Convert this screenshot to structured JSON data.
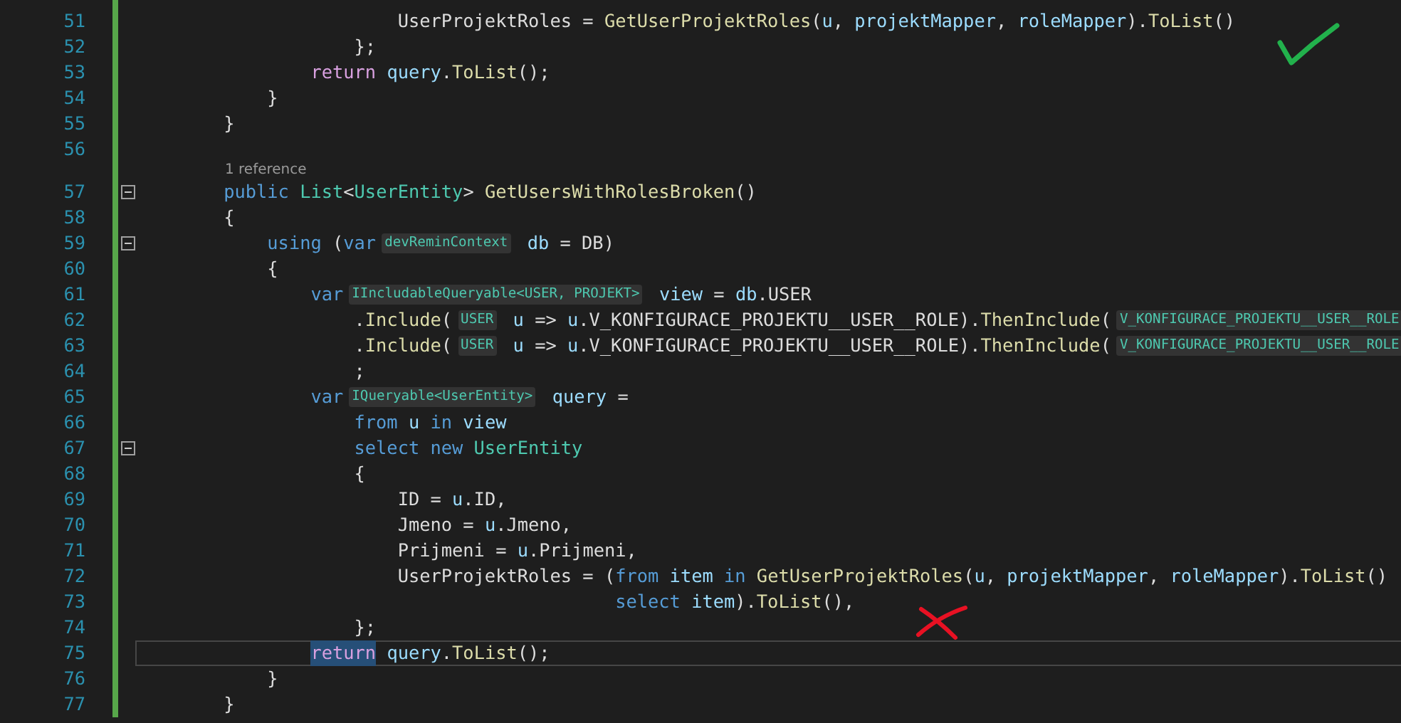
{
  "editor": {
    "modified": true,
    "lines": [
      {
        "kind": "code",
        "number": "51",
        "tokens": [
          {
            "text": "                        UserProjektRoles = ",
            "kind": "plain"
          },
          {
            "text": "GetUserProjektRoles",
            "kind": "method"
          },
          {
            "text": "(",
            "kind": "plain"
          },
          {
            "text": "u",
            "kind": "local"
          },
          {
            "text": ", ",
            "kind": "plain"
          },
          {
            "text": "projektMapper",
            "kind": "local"
          },
          {
            "text": ", ",
            "kind": "plain"
          },
          {
            "text": "roleMapper",
            "kind": "local"
          },
          {
            "text": ").",
            "kind": "plain"
          },
          {
            "text": "ToList",
            "kind": "method"
          },
          {
            "text": "()",
            "kind": "plain"
          }
        ]
      },
      {
        "kind": "code",
        "number": "52",
        "tokens": [
          {
            "text": "                    };",
            "kind": "plain"
          }
        ]
      },
      {
        "kind": "code",
        "number": "53",
        "tokens": [
          {
            "text": "                return",
            "kind": "control"
          },
          {
            "text": " query",
            "kind": "local"
          },
          {
            "text": ".",
            "kind": "plain"
          },
          {
            "text": "ToList",
            "kind": "method"
          },
          {
            "text": "();",
            "kind": "plain"
          }
        ]
      },
      {
        "kind": "code",
        "number": "54",
        "tokens": [
          {
            "text": "            }",
            "kind": "plain"
          }
        ]
      },
      {
        "kind": "code",
        "number": "55",
        "tokens": [
          {
            "text": "        }",
            "kind": "plain"
          }
        ]
      },
      {
        "kind": "code",
        "number": "56"
      },
      {
        "kind": "codelens",
        "text": "1 reference"
      },
      {
        "kind": "code",
        "number": "57",
        "expanded": true,
        "tokens": [
          {
            "text": "        public",
            "kind": "keyword"
          },
          {
            "text": " List",
            "kind": "type"
          },
          {
            "text": "<",
            "kind": "plain"
          },
          {
            "text": "UserEntity",
            "kind": "type"
          },
          {
            "text": "> ",
            "kind": "plain"
          },
          {
            "text": "GetUsersWithRolesBroken",
            "kind": "method"
          },
          {
            "text": "()",
            "kind": "plain"
          }
        ]
      },
      {
        "kind": "code",
        "number": "58",
        "tokens": [
          {
            "text": "        {",
            "kind": "plain"
          }
        ]
      },
      {
        "kind": "code",
        "number": "59",
        "expanded": true,
        "tokens": [
          {
            "text": "            using",
            "kind": "keyword"
          },
          {
            "text": " (",
            "kind": "plain"
          },
          {
            "text": "var",
            "kind": "keyword"
          },
          {
            "text": "devReminContext",
            "kind": "hint"
          },
          {
            "text": " db",
            "kind": "local"
          },
          {
            "text": " = DB)",
            "kind": "plain"
          }
        ]
      },
      {
        "kind": "code",
        "number": "60",
        "tokens": [
          {
            "text": "            {",
            "kind": "plain"
          }
        ]
      },
      {
        "kind": "code",
        "number": "61",
        "tokens": [
          {
            "text": "                var",
            "kind": "keyword"
          },
          {
            "text": "IIncludableQueryable<USER, PROJEKT>",
            "kind": "hint"
          },
          {
            "text": " view",
            "kind": "local"
          },
          {
            "text": " = ",
            "kind": "plain"
          },
          {
            "text": "db",
            "kind": "local"
          },
          {
            "text": ".USER",
            "kind": "plain"
          }
        ]
      },
      {
        "kind": "code",
        "number": "62",
        "tokens": [
          {
            "text": "                    .",
            "kind": "plain"
          },
          {
            "text": "Include",
            "kind": "method"
          },
          {
            "text": "(",
            "kind": "plain"
          },
          {
            "text": "USER",
            "kind": "hint"
          },
          {
            "text": " u",
            "kind": "local"
          },
          {
            "text": " => ",
            "kind": "plain"
          },
          {
            "text": "u",
            "kind": "local"
          },
          {
            "text": ".V_KONFIGURACE_PROJEKTU__USER__ROLE).",
            "kind": "plain"
          },
          {
            "text": "ThenInclude",
            "kind": "method"
          },
          {
            "text": "(",
            "kind": "plain"
          },
          {
            "text": "V_KONFIGURACE_PROJEKTU__USER__ROLE",
            "kind": "hint"
          }
        ]
      },
      {
        "kind": "code",
        "number": "63",
        "tokens": [
          {
            "text": "                    .",
            "kind": "plain"
          },
          {
            "text": "Include",
            "kind": "method"
          },
          {
            "text": "(",
            "kind": "plain"
          },
          {
            "text": "USER",
            "kind": "hint"
          },
          {
            "text": " u",
            "kind": "local"
          },
          {
            "text": " => ",
            "kind": "plain"
          },
          {
            "text": "u",
            "kind": "local"
          },
          {
            "text": ".V_KONFIGURACE_PROJEKTU__USER__ROLE).",
            "kind": "plain"
          },
          {
            "text": "ThenInclude",
            "kind": "method"
          },
          {
            "text": "(",
            "kind": "plain"
          },
          {
            "text": "V_KONFIGURACE_PROJEKTU__USER__ROLE",
            "kind": "hint"
          }
        ]
      },
      {
        "kind": "code",
        "number": "64",
        "tokens": [
          {
            "text": "                    ;",
            "kind": "plain"
          }
        ]
      },
      {
        "kind": "code",
        "number": "65",
        "tokens": [
          {
            "text": "                var",
            "kind": "keyword"
          },
          {
            "text": "IQueryable<UserEntity>",
            "kind": "hint"
          },
          {
            "text": " query",
            "kind": "local"
          },
          {
            "text": " =",
            "kind": "plain"
          }
        ]
      },
      {
        "kind": "code",
        "number": "66",
        "tokens": [
          {
            "text": "                    from",
            "kind": "keyword"
          },
          {
            "text": " u",
            "kind": "local"
          },
          {
            "text": " in",
            "kind": "keyword"
          },
          {
            "text": " view",
            "kind": "local"
          }
        ]
      },
      {
        "kind": "code",
        "number": "67",
        "expanded": true,
        "tokens": [
          {
            "text": "                    select new",
            "kind": "keyword"
          },
          {
            "text": " UserEntity",
            "kind": "type"
          }
        ]
      },
      {
        "kind": "code",
        "number": "68",
        "tokens": [
          {
            "text": "                    {",
            "kind": "plain"
          }
        ]
      },
      {
        "kind": "code",
        "number": "69",
        "tokens": [
          {
            "text": "                        ID = ",
            "kind": "plain"
          },
          {
            "text": "u",
            "kind": "local"
          },
          {
            "text": ".ID,",
            "kind": "plain"
          }
        ]
      },
      {
        "kind": "code",
        "number": "70",
        "tokens": [
          {
            "text": "                        Jmeno = ",
            "kind": "plain"
          },
          {
            "text": "u",
            "kind": "local"
          },
          {
            "text": ".Jmeno,",
            "kind": "plain"
          }
        ]
      },
      {
        "kind": "code",
        "number": "71",
        "tokens": [
          {
            "text": "                        Prijmeni = ",
            "kind": "plain"
          },
          {
            "text": "u",
            "kind": "local"
          },
          {
            "text": ".Prijmeni,",
            "kind": "plain"
          }
        ]
      },
      {
        "kind": "code",
        "number": "72",
        "tokens": [
          {
            "text": "                        UserProjektRoles = (",
            "kind": "plain"
          },
          {
            "text": "from",
            "kind": "keyword"
          },
          {
            "text": " item",
            "kind": "local"
          },
          {
            "text": " in",
            "kind": "keyword"
          },
          {
            "text": " GetUserProjektRoles",
            "kind": "method"
          },
          {
            "text": "(",
            "kind": "plain"
          },
          {
            "text": "u",
            "kind": "local"
          },
          {
            "text": ", ",
            "kind": "plain"
          },
          {
            "text": "projektMapper",
            "kind": "local"
          },
          {
            "text": ", ",
            "kind": "plain"
          },
          {
            "text": "roleMapper",
            "kind": "local"
          },
          {
            "text": ").",
            "kind": "plain"
          },
          {
            "text": "ToList",
            "kind": "method"
          },
          {
            "text": "()",
            "kind": "plain"
          }
        ]
      },
      {
        "kind": "code",
        "number": "73",
        "tokens": [
          {
            "text": "                                            select",
            "kind": "keyword"
          },
          {
            "text": " item",
            "kind": "local"
          },
          {
            "text": ").",
            "kind": "plain"
          },
          {
            "text": "ToList",
            "kind": "method"
          },
          {
            "text": "(),",
            "kind": "plain"
          }
        ]
      },
      {
        "kind": "code",
        "number": "74",
        "tokens": [
          {
            "text": "                    };",
            "kind": "plain"
          }
        ]
      },
      {
        "kind": "code",
        "number": "75",
        "current": true,
        "tokens": [
          {
            "text": "                return",
            "kind": "control",
            "highlighted": true
          },
          {
            "text": " query",
            "kind": "local"
          },
          {
            "text": ".",
            "kind": "plain"
          },
          {
            "text": "ToList",
            "kind": "method"
          },
          {
            "text": "();",
            "kind": "plain"
          }
        ]
      },
      {
        "kind": "code",
        "number": "76",
        "tokens": [
          {
            "text": "            }",
            "kind": "plain"
          }
        ]
      },
      {
        "kind": "code",
        "number": "77",
        "tokens": [
          {
            "text": "        }",
            "kind": "plain"
          }
        ]
      }
    ]
  },
  "annotations": [
    {
      "kind": "check"
    },
    {
      "kind": "cross"
    }
  ]
}
